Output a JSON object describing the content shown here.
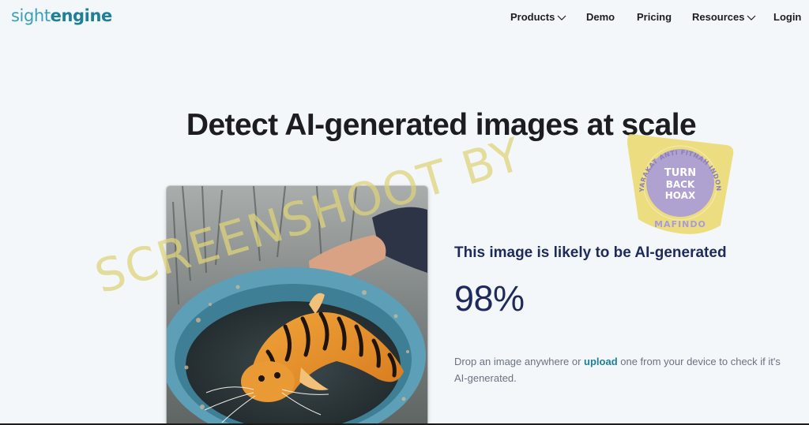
{
  "header": {
    "logo_part1": "sight",
    "logo_part2": "engine",
    "nav": {
      "products": "Products",
      "demo": "Demo",
      "pricing": "Pricing",
      "resources": "Resources",
      "login": "Login"
    }
  },
  "hero": {
    "title": "Detect AI-generated images at scale"
  },
  "result": {
    "title": "This image is likely to be AI-generated",
    "score": "98%",
    "desc_before": "Drop an image anywhere or ",
    "desc_link": "upload",
    "desc_after": " one from your device to check if it's AI-generated."
  },
  "watermark": {
    "text": "SCREENSHOOT BY",
    "badge_arc": "MASYARAKAT ANTI FITNAH INDONESIA",
    "badge_line1": "TURN",
    "badge_line2": "BACK",
    "badge_line3": "HOAX",
    "badge_bottom": "MAFINDO"
  },
  "colors": {
    "brand_light": "#3aa0b8",
    "brand_dark": "#1d7f98",
    "navy": "#1f2a5c",
    "watermark": "#ddd37a",
    "badge_purple": "#a99ad8"
  }
}
